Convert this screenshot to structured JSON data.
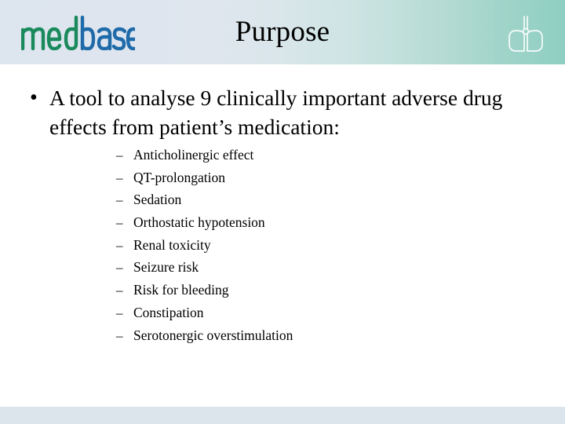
{
  "slide": {
    "title": "Purpose",
    "brand_logo_text": "medbase",
    "brand_logo_part_green": "med",
    "brand_logo_part_blue": "base",
    "monogram_text": "db",
    "colors": {
      "logo_green": "#1a8a5c",
      "logo_blue": "#1f6aa8",
      "header_left": "#dde5ef",
      "header_right": "#8fcec2",
      "footer": "#dde5ec",
      "text": "#000000",
      "monogram_outline": "#ffffff"
    }
  },
  "content": {
    "main_bullet_marker": "•",
    "main_bullet_text": "A tool to analyse 9 clinically important adverse drug effects from patient’s medication:",
    "sub_bullet_marker": "–",
    "sub_bullets": [
      "Anticholinergic effect",
      "QT-prolongation",
      "Sedation",
      "Orthostatic hypotension",
      "Renal toxicity",
      "Seizure risk",
      "Risk for bleeding",
      "Constipation",
      "Serotonergic overstimulation"
    ]
  }
}
